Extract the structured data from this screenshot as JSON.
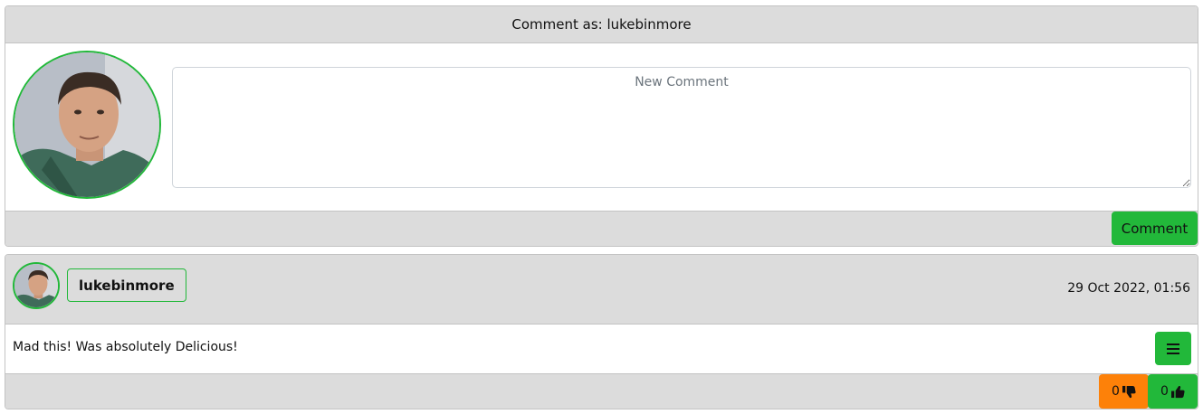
{
  "new_comment": {
    "header": "Comment as: lukebinmore",
    "placeholder": "New Comment",
    "submit_label": "Comment"
  },
  "comment": {
    "author": "lukebinmore",
    "date": "29 Oct 2022, 01:56",
    "text": "Mad this! Was absolutely Delicious!",
    "dislikes": "0",
    "likes": "0"
  },
  "colors": {
    "accent_green": "#22b83a",
    "dislike_orange": "#fd8109",
    "bar_gray": "#dcdcdc"
  },
  "icons": {
    "menu": "hamburger-icon",
    "dislike": "thumbs-down-icon",
    "like": "thumbs-up-icon"
  }
}
